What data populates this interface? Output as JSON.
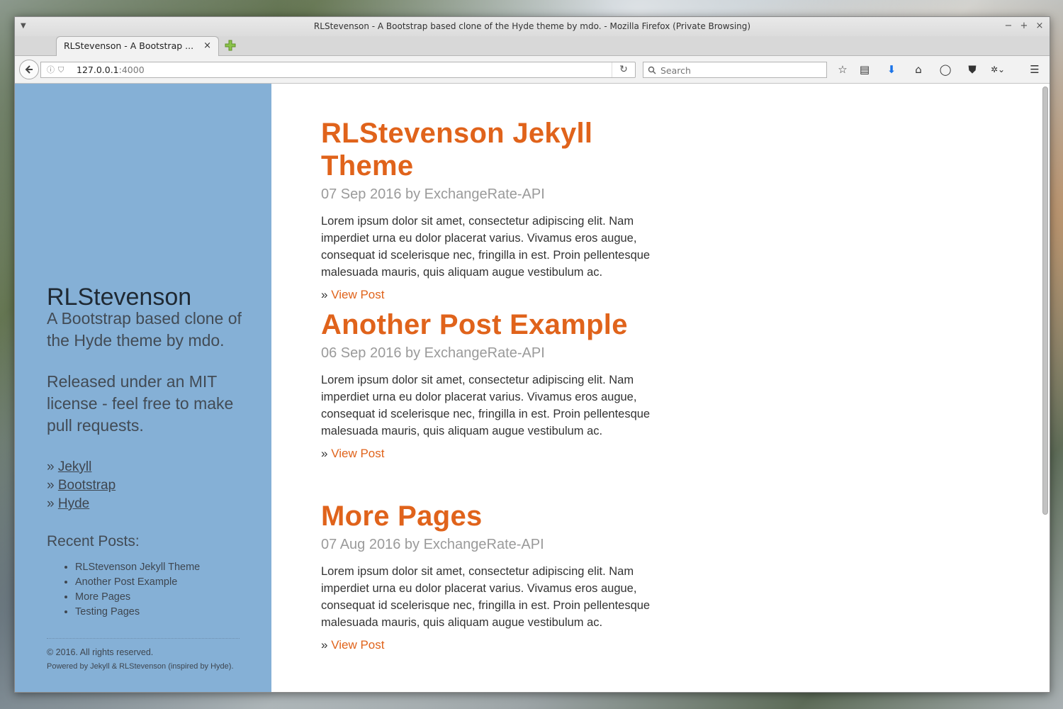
{
  "window": {
    "title": "RLStevenson - A Bootstrap based clone of the Hyde theme by mdo. - Mozilla Firefox (Private Browsing)",
    "controls": [
      "−",
      "+",
      "×"
    ]
  },
  "tab": {
    "label": "RLStevenson - A Bootstrap ...",
    "close": "×"
  },
  "navbar": {
    "url_host": "127.0.0.1",
    "url_port": ":4000",
    "search_placeholder": "Search"
  },
  "sidebar": {
    "title": "RLStevenson",
    "description": "A Bootstrap based clone of the Hyde theme by mdo.",
    "license": "Released under an MIT license - feel free to make pull requests.",
    "links": [
      "Jekyll",
      "Bootstrap",
      "Hyde"
    ],
    "link_prefix": "»",
    "recent_title": "Recent Posts:",
    "recent": [
      "RLStevenson Jekyll Theme",
      "Another Post Example",
      "More Pages",
      "Testing Pages"
    ],
    "copyright": "© 2016. All rights reserved.",
    "powered": "Powered by Jekyll & RLStevenson (inspired by Hyde)."
  },
  "posts": [
    {
      "title": "RLStevenson Jekyll Theme",
      "meta": "07 Sep 2016 by ExchangeRate-API",
      "body": "Lorem ipsum dolor sit amet, consectetur adipiscing elit. Nam imperdiet urna eu dolor placerat varius. Vivamus eros augue, consequat id scelerisque nec, fringilla in est. Proin pellentesque malesuada mauris, quis aliquam augue vestibulum ac.",
      "link_prefix": "»",
      "link": "View Post"
    },
    {
      "title": "Another Post Example",
      "meta": "06 Sep 2016 by ExchangeRate-API",
      "body": "Lorem ipsum dolor sit amet, consectetur adipiscing elit. Nam imperdiet urna eu dolor placerat varius. Vivamus eros augue, consequat id scelerisque nec, fringilla in est. Proin pellentesque malesuada mauris, quis aliquam augue vestibulum ac.",
      "link_prefix": "»",
      "link": "View Post"
    },
    {
      "title": "More Pages",
      "meta": "07 Aug 2016 by ExchangeRate-API",
      "body": "Lorem ipsum dolor sit amet, consectetur adipiscing elit. Nam imperdiet urna eu dolor placerat varius. Vivamus eros augue, consequat id scelerisque nec, fringilla in est. Proin pellentesque malesuada mauris, quis aliquam augue vestibulum ac.",
      "link_prefix": "»",
      "link": "View Post"
    }
  ],
  "colors": {
    "sidebar_bg": "#85b0d6",
    "accent": "#e0631b",
    "meta_text": "#9a9a9a"
  },
  "icons": [
    "menu-arrow-icon",
    "new-tab-icon",
    "back-icon",
    "info-icon",
    "shield-icon",
    "reload-icon",
    "search-icon",
    "bookmark-star-icon",
    "reading-list-icon",
    "download-icon",
    "home-icon",
    "chat-icon",
    "pocket-icon",
    "extension-icon",
    "hamburger-menu-icon"
  ]
}
